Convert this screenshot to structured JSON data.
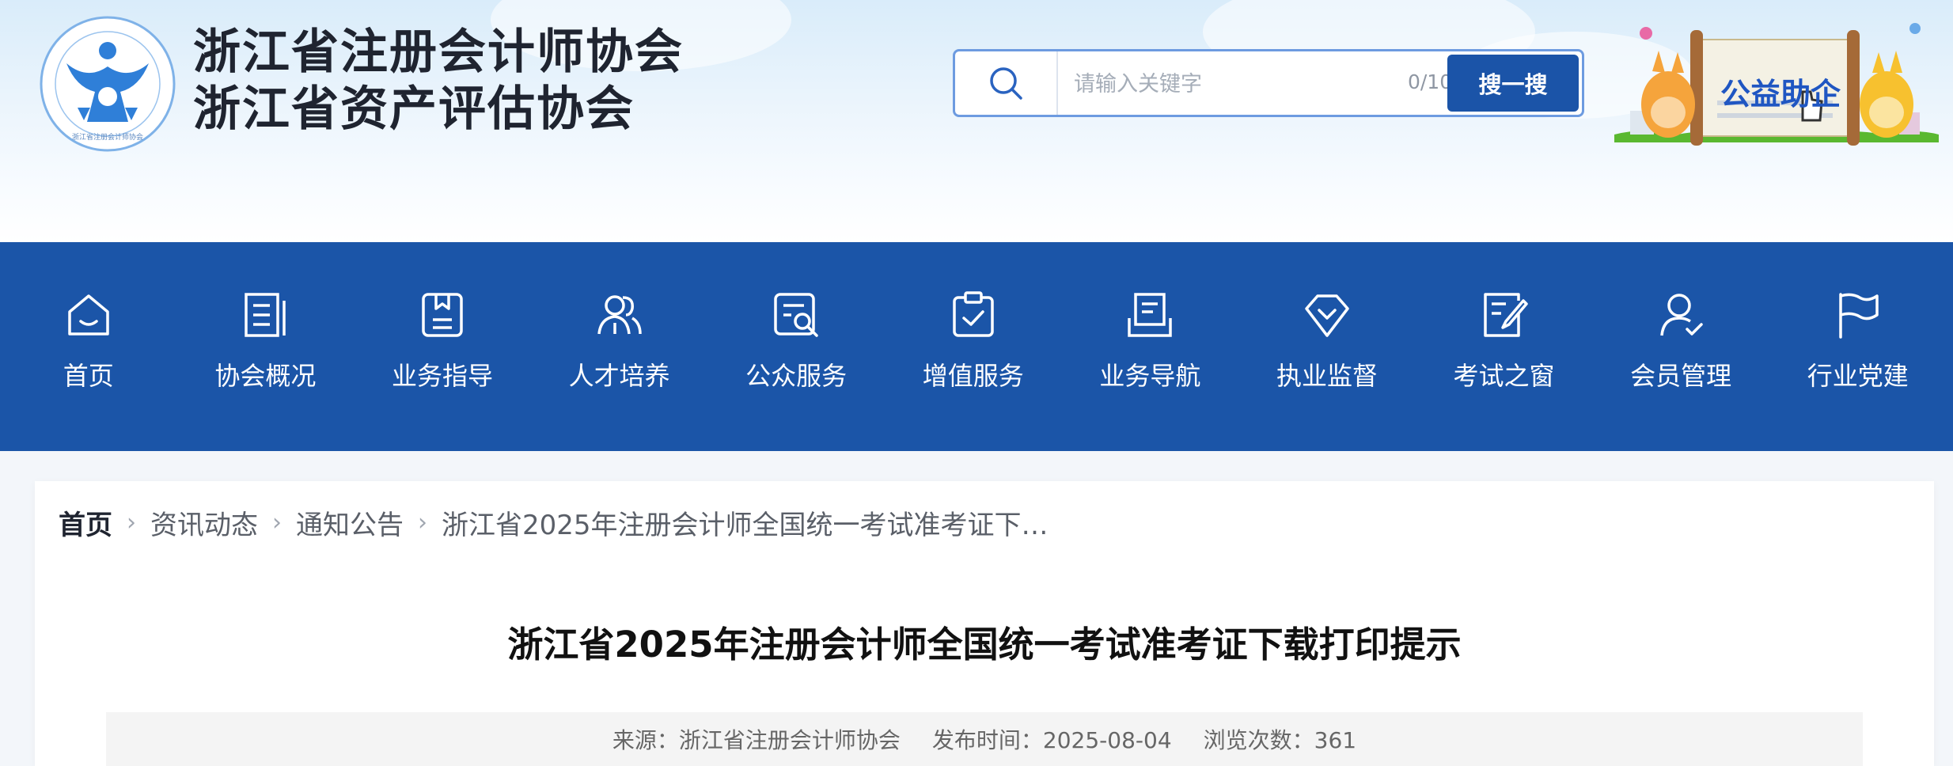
{
  "header": {
    "org_name_1": "浙江省注册会计师协会",
    "org_name_2": "浙江省资产评估协会",
    "logo_text": "ZHE JIANG INSTITUTE OF CERTIFIED PUBLIC ACCOUNTANTS · 浙江省注册会计师协会",
    "search": {
      "placeholder": "请输入关键字",
      "value": "",
      "counter": "0/100",
      "button_label": "搜一搜",
      "icon": "search-icon"
    },
    "banner_text": "公益助企"
  },
  "nav": {
    "items": [
      {
        "label": "首页",
        "icon": "home-icon"
      },
      {
        "label": "协会概况",
        "icon": "document-icon"
      },
      {
        "label": "业务指导",
        "icon": "bookmark-book-icon"
      },
      {
        "label": "人才培养",
        "icon": "people-icon"
      },
      {
        "label": "公众服务",
        "icon": "search-document-icon"
      },
      {
        "label": "增值服务",
        "icon": "clipboard-check-icon"
      },
      {
        "label": "业务导航",
        "icon": "book-stack-icon"
      },
      {
        "label": "执业监督",
        "icon": "diamond-check-icon"
      },
      {
        "label": "考试之窗",
        "icon": "edit-document-icon"
      },
      {
        "label": "会员管理",
        "icon": "user-check-icon"
      },
      {
        "label": "行业党建",
        "icon": "flag-icon"
      }
    ]
  },
  "breadcrumb": {
    "home": "首页",
    "level1": "资讯动态",
    "level2": "通知公告",
    "current": "浙江省2025年注册会计师全国统一考试准考证下…",
    "separator": "›"
  },
  "article": {
    "title": "浙江省2025年注册会计师全国统一考试准考证下载打印提示",
    "source": "来源：浙江省注册会计师协会",
    "publish_time": "发布时间：2025-08-04",
    "views": "浏览次数：361"
  },
  "colors": {
    "nav_bg": "#1b55a8",
    "button_bg": "#1b54a8",
    "search_border": "#6d9be0",
    "logo_blue": "#2f7fd8"
  }
}
